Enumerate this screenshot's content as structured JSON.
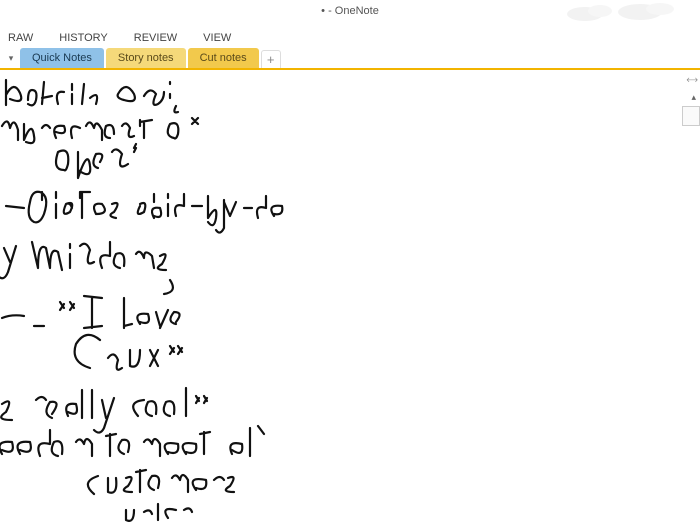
{
  "titlebar": {
    "title": "• - OneNote"
  },
  "ribbon": {
    "tabs": [
      {
        "label": "RAW"
      },
      {
        "label": "HISTORY"
      },
      {
        "label": "REVIEW"
      },
      {
        "label": "VIEW"
      }
    ]
  },
  "sections": {
    "tabs": [
      {
        "label": "Quick Notes",
        "color": "blue",
        "active": true
      },
      {
        "label": "Story notes",
        "color": "yellow"
      },
      {
        "label": "Cut notes",
        "color": "yellow2"
      }
    ],
    "add_label": "+"
  },
  "handwriting": {
    "lines": [
      "built am;",
      "mbracment o",
      "open",
      "distos side-by-de",
      "y Windows",
      "- \"I love",
      "Cnux\"",
      "s really cool\"",
      "eedom to meet al",
      "customers",
      "urler"
    ]
  }
}
